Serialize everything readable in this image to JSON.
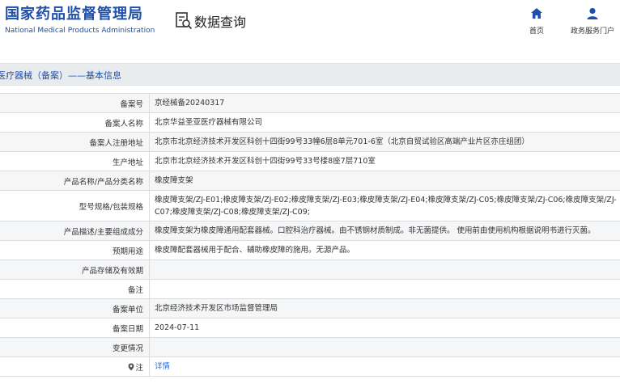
{
  "header": {
    "logo_cn": "国家药品监督管理局",
    "logo_en": "National Medical Products Administration",
    "query_label": "数据查询",
    "nav_home": "首页",
    "nav_service": "政务服务门户"
  },
  "titlebar": {
    "text": "医疗器械（备案）——基本信息"
  },
  "rows": [
    {
      "label": "备案号",
      "value": "京经械备20240317"
    },
    {
      "label": "备案人名称",
      "value": "北京华益圣亚医疗器械有限公司"
    },
    {
      "label": "备案人注册地址",
      "value": "北京市北京经济技术开发区科创十四街99号33幢6层8单元701-6室（北京自贸试验区高端产业片区亦庄组团）"
    },
    {
      "label": "生产地址",
      "value": "北京市北京经济技术开发区科创十四街99号33号楼8座7层710室"
    },
    {
      "label": "产品名称/产品分类名称",
      "value": "橡皮障支架"
    },
    {
      "label": "型号规格/包装规格",
      "value": "橡皮障支架/ZJ-E01;橡皮障支架/ZJ-E02;橡皮障支架/ZJ-E03;橡皮障支架/ZJ-E04;橡皮障支架/ZJ-C05;橡皮障支架/ZJ-C06;橡皮障支架/ZJ-C07;橡皮障支架/ZJ-C08;橡皮障支架/ZJ-C09;"
    },
    {
      "label": "产品描述/主要组成成分",
      "value": "橡皮障支架为橡皮障通用配套器械。口腔科治疗器械。由不锈钢材质制成。非无菌提供。 使用前由使用机构根据说明书进行灭菌。"
    },
    {
      "label": "预期用途",
      "value": "橡皮障配套器械用于配合、辅助橡皮障的施用。无源产品。"
    },
    {
      "label": "产品存储及有效期",
      "value": ""
    },
    {
      "label": "备注",
      "value": ""
    },
    {
      "label": "备案单位",
      "value": "北京经济技术开发区市场监督管理局"
    },
    {
      "label": "备案日期",
      "value": "2024-07-11"
    },
    {
      "label": "变更情况",
      "value": ""
    },
    {
      "label": "注",
      "value": "详情"
    }
  ],
  "colors": {
    "brand_blue": "#1f4fa8",
    "link_blue": "#2a6fd6"
  }
}
